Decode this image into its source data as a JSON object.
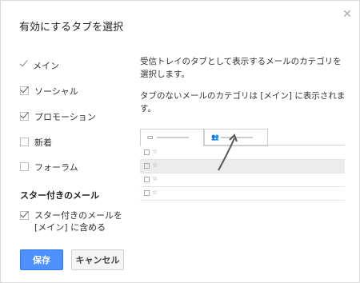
{
  "dialog": {
    "title": "有効にするタブを選択",
    "close_icon": "close-icon"
  },
  "options": [
    {
      "label": "メイン",
      "checked": true,
      "locked": true
    },
    {
      "label": "ソーシャル",
      "checked": true
    },
    {
      "label": "プロモーション",
      "checked": true
    },
    {
      "label": "新着",
      "checked": false
    },
    {
      "label": "フォーラム",
      "checked": false
    }
  ],
  "starred": {
    "heading": "スター付きのメール",
    "option_line1": "スター付きのメールを",
    "option_line2": "[メイン] に含める",
    "checked": true
  },
  "description": {
    "line1": "受信トレイのタブとして表示するメールのカテゴリを",
    "line2": "選択します。",
    "line3": "タブのないメールのカテゴリは [メイン] に表示されま",
    "line4": "す。"
  },
  "preview": {
    "tab1_icon": "inbox-icon",
    "tab2_icon": "people-icon",
    "row_glyphs": "☐ ☆"
  },
  "buttons": {
    "save": "保存",
    "cancel": "キャンセル"
  },
  "colors": {
    "accent": "#4d90fe"
  }
}
